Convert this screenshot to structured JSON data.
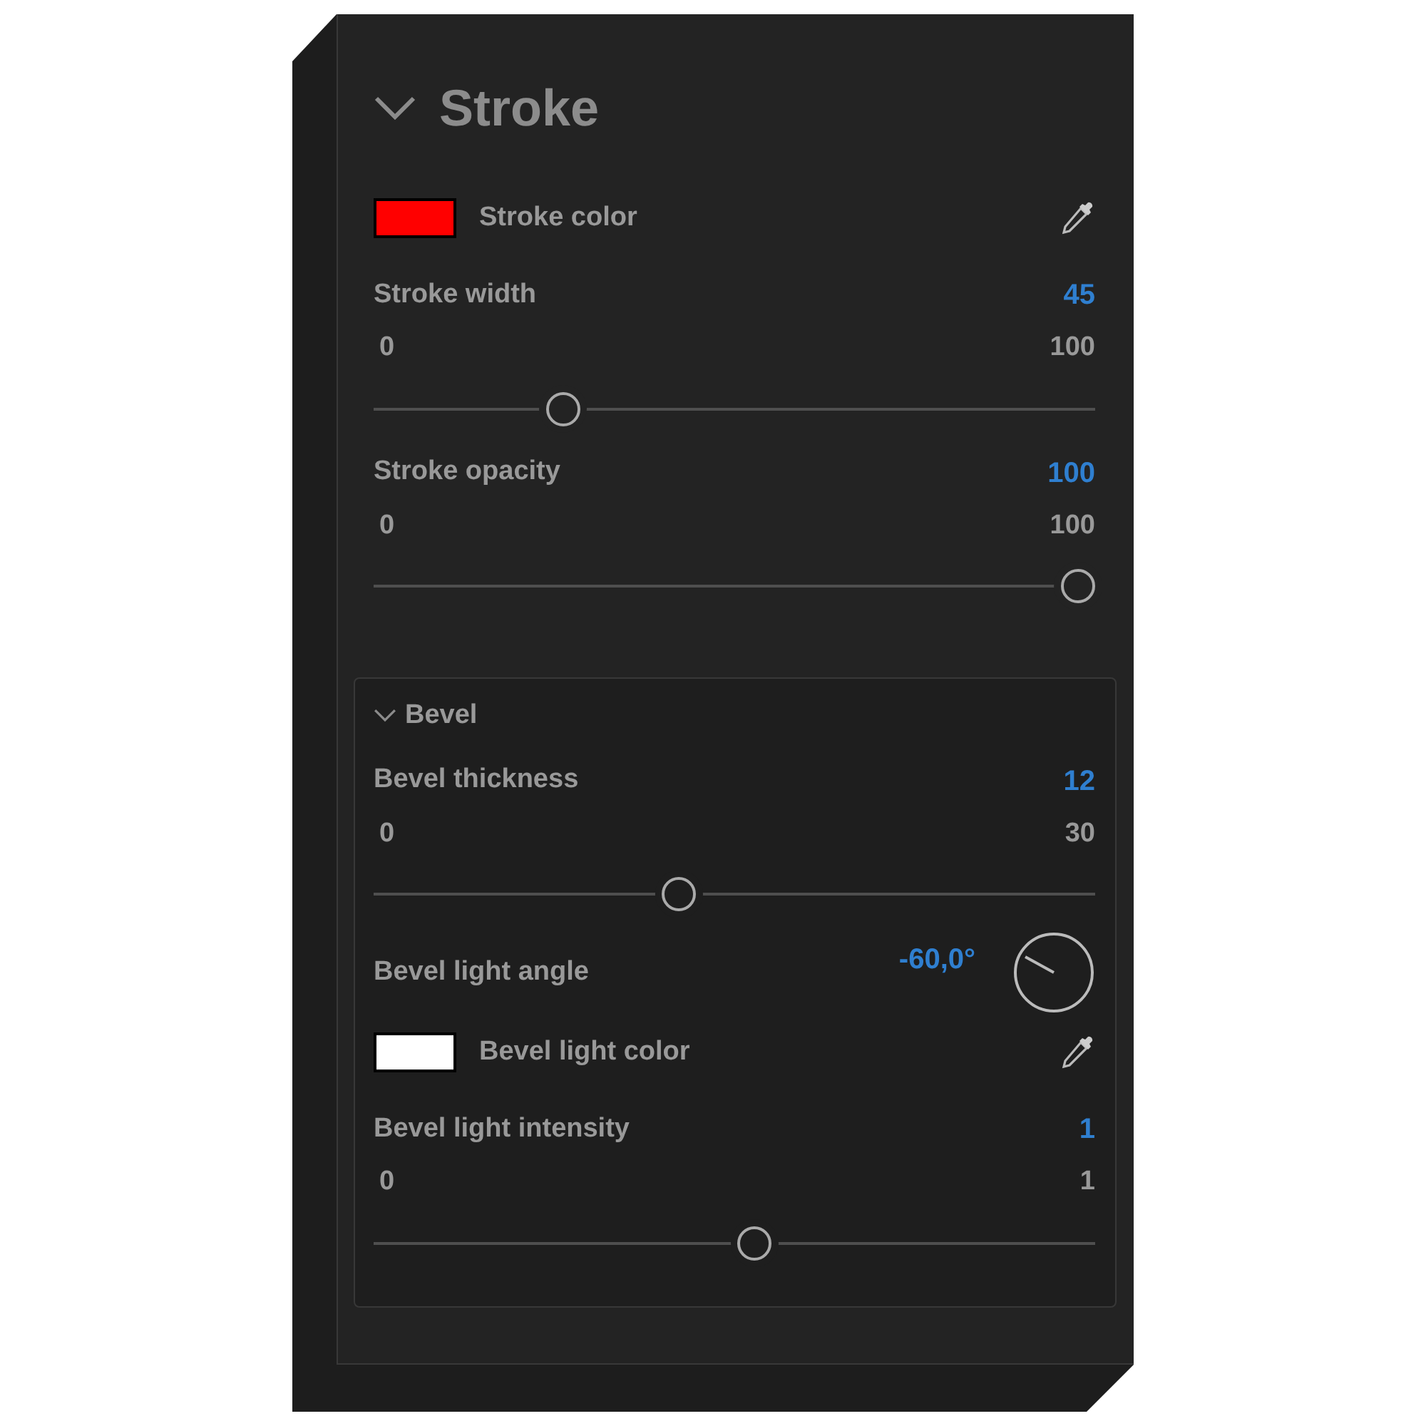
{
  "section": {
    "title": "Stroke",
    "expanded": true,
    "rows": [
      {
        "kind": "color",
        "label": "Stroke color",
        "color": "#ff0000"
      },
      {
        "kind": "slider",
        "label": "Stroke width",
        "value": "45",
        "min": "0",
        "max": "100",
        "level": 0.25
      },
      {
        "kind": "slider",
        "label": "Stroke opacity",
        "value": "100",
        "min": "0",
        "max": "100",
        "level": 1
      }
    ],
    "subsection": {
      "title": "Bevel",
      "expanded": true,
      "rows": [
        {
          "kind": "slider",
          "label": "Bevel thickness",
          "value": "12",
          "min": "0",
          "max": "30",
          "level": 0.42
        },
        {
          "kind": "angle",
          "label": "Bevel light angle",
          "value": "-60,0°"
        },
        {
          "kind": "color",
          "label": "Bevel light color",
          "color": "#ffffff"
        },
        {
          "kind": "slider",
          "label": "Bevel light intensity",
          "value": "1",
          "min": "0",
          "max": "1",
          "level": 0.53
        }
      ]
    }
  }
}
